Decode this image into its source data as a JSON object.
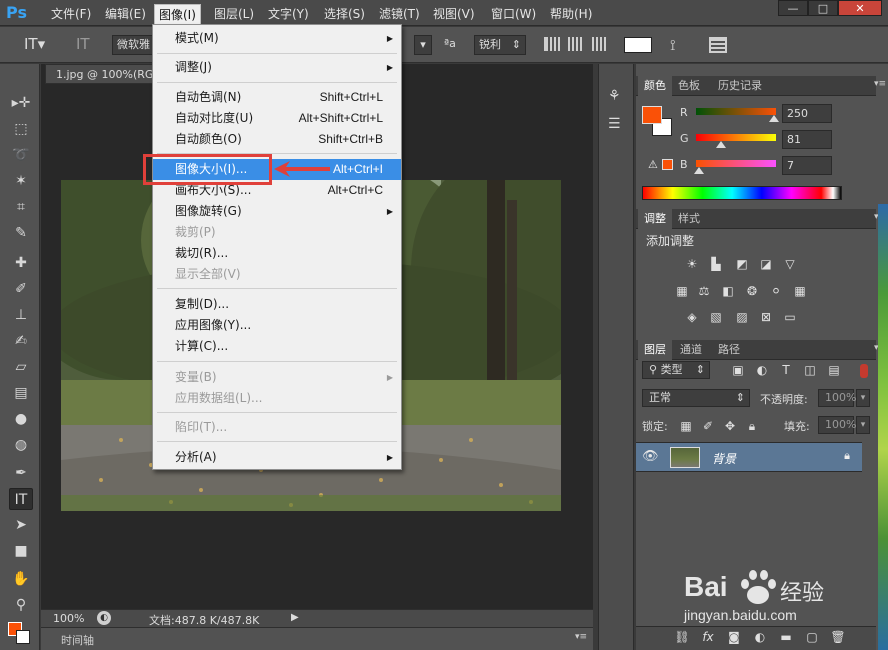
{
  "menubar": {
    "logo": "Ps",
    "items": [
      {
        "label": "文件(F)"
      },
      {
        "label": "编辑(E)"
      },
      {
        "label": "图像(I)"
      },
      {
        "label": "图层(L)"
      },
      {
        "label": "文字(Y)"
      },
      {
        "label": "选择(S)"
      },
      {
        "label": "滤镜(T)"
      },
      {
        "label": "视图(V)"
      },
      {
        "label": "窗口(W)"
      },
      {
        "label": "帮助(H)"
      }
    ],
    "window_controls": [
      "—",
      "□",
      "✕"
    ]
  },
  "options": {
    "font_family": "微软雅",
    "antialias": "锐利",
    "aa_label": "ªa"
  },
  "document": {
    "tab_title": "1.jpg @ 100%(RGB",
    "zoom": "100%",
    "doc_size": "文档:487.8 K/487.8K",
    "timeline_label": "时间轴"
  },
  "image_menu": {
    "items": [
      {
        "label": "模式(M)",
        "shortcut": "",
        "submenu": true,
        "disabled": false
      },
      {
        "label": "调整(J)",
        "shortcut": "",
        "submenu": true,
        "disabled": false
      },
      {
        "label": "自动色调(N)",
        "shortcut": "Shift+Ctrl+L",
        "submenu": false,
        "disabled": false
      },
      {
        "label": "自动对比度(U)",
        "shortcut": "Alt+Shift+Ctrl+L",
        "submenu": false,
        "disabled": false
      },
      {
        "label": "自动颜色(O)",
        "shortcut": "Shift+Ctrl+B",
        "submenu": false,
        "disabled": false
      },
      {
        "label": "图像大小(I)...",
        "shortcut": "Alt+Ctrl+I",
        "submenu": false,
        "disabled": false
      },
      {
        "label": "画布大小(S)...",
        "shortcut": "Alt+Ctrl+C",
        "submenu": false,
        "disabled": false
      },
      {
        "label": "图像旋转(G)",
        "shortcut": "",
        "submenu": true,
        "disabled": false
      },
      {
        "label": "裁剪(P)",
        "shortcut": "",
        "submenu": false,
        "disabled": true
      },
      {
        "label": "裁切(R)...",
        "shortcut": "",
        "submenu": false,
        "disabled": false
      },
      {
        "label": "显示全部(V)",
        "shortcut": "",
        "submenu": false,
        "disabled": true
      },
      {
        "label": "复制(D)...",
        "shortcut": "",
        "submenu": false,
        "disabled": false
      },
      {
        "label": "应用图像(Y)...",
        "shortcut": "",
        "submenu": false,
        "disabled": false
      },
      {
        "label": "计算(C)...",
        "shortcut": "",
        "submenu": false,
        "disabled": false
      },
      {
        "label": "变量(B)",
        "shortcut": "",
        "submenu": true,
        "disabled": true
      },
      {
        "label": "应用数据组(L)...",
        "shortcut": "",
        "submenu": false,
        "disabled": true
      },
      {
        "label": "陷印(T)...",
        "shortcut": "",
        "submenu": false,
        "disabled": true
      },
      {
        "label": "分析(A)",
        "shortcut": "",
        "submenu": true,
        "disabled": false
      }
    ],
    "highlighted_index": 5
  },
  "color_panel": {
    "tabs": [
      "颜色",
      "色板",
      "历史记录"
    ],
    "R": {
      "label": "R",
      "value": "250"
    },
    "G": {
      "label": "G",
      "value": "81"
    },
    "B": {
      "label": "B",
      "value": "7"
    },
    "foreground_color": "#fa5107",
    "background_color": "#ffffff"
  },
  "adjust_panel": {
    "tabs": [
      "调整",
      "样式"
    ],
    "title": "添加调整"
  },
  "layers_panel": {
    "tabs": [
      "图层",
      "通道",
      "路径"
    ],
    "filter_kind": "类型",
    "blend_mode": "正常",
    "opacity_label": "不透明度:",
    "opacity_value": "100%",
    "lock_label": "锁定:",
    "fill_label": "填充:",
    "fill_value": "100%",
    "layers": [
      {
        "name": "背景",
        "visible": true,
        "locked": true
      }
    ]
  },
  "watermark": {
    "brand_left": "Bai",
    "brand_right": "经验",
    "url": "jingyan.baidu.com"
  },
  "colors": {
    "accent_highlight": "#3a8ee6",
    "annotation_red": "#e0403a"
  }
}
